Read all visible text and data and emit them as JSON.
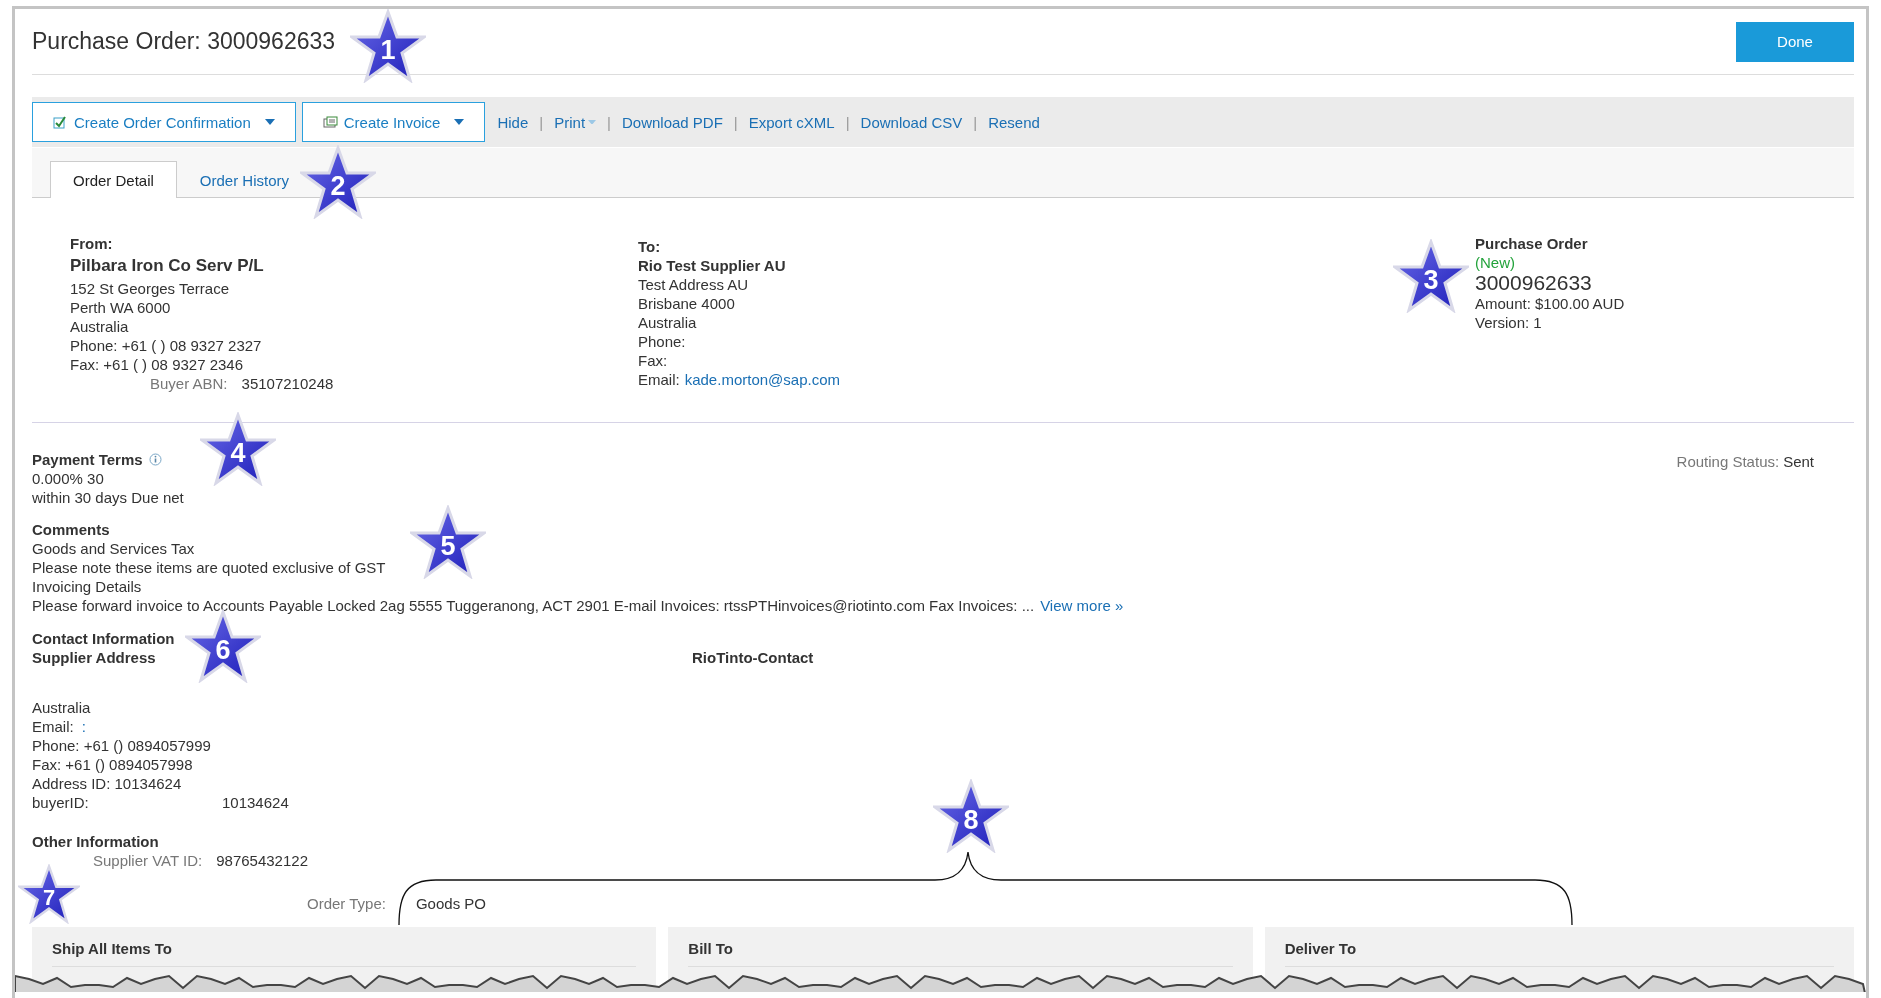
{
  "title": "Purchase Order: 3000962633",
  "done_button": "Done",
  "toolbar": {
    "buttons": [
      {
        "label": "Create Order Confirmation"
      },
      {
        "label": "Create Invoice"
      }
    ],
    "links": [
      {
        "label": "Hide",
        "dropdown": false
      },
      {
        "label": "Print",
        "dropdown": true,
        "separator_before": "|"
      },
      {
        "label": "Download PDF",
        "dropdown": false,
        "separator_before": "|"
      },
      {
        "label": "Export cXML",
        "dropdown": false,
        "separator_before": "|"
      },
      {
        "label": "Download CSV",
        "dropdown": false,
        "separator_before": "|"
      },
      {
        "label": "Resend",
        "dropdown": false,
        "separator_before": "|"
      }
    ]
  },
  "tabs": [
    {
      "label": "Order Detail",
      "selected": true
    },
    {
      "label": "Order History",
      "selected": false
    }
  ],
  "from": {
    "heading": "From:",
    "name": "Pilbara Iron Co Serv P/L",
    "lines": [
      "152 St Georges Terrace",
      "Perth WA 6000",
      "Australia",
      "Phone:  +61 ( ) 08 9327 2327",
      "Fax:  +61 ( ) 08 9327 2346"
    ],
    "buyer_abn": {
      "label": "Buyer ABN:",
      "value": "35107210248"
    }
  },
  "to": {
    "heading": "To:",
    "name": "Rio Test Supplier AU",
    "lines": [
      "Test Address AU",
      "Brisbane 4000",
      "Australia",
      "Phone:",
      "Fax:"
    ],
    "email": {
      "label": "Email:",
      "value": "kade.morton@sap.com"
    }
  },
  "po_summary": {
    "heading": "Purchase Order",
    "status": "(New)",
    "number": "3000962633",
    "amount": "Amount: $100.00 AUD",
    "version": "Version: 1"
  },
  "payment_terms": {
    "heading": "Payment Terms",
    "lines": [
      "0.000% 30",
      "within 30 days Due net"
    ]
  },
  "routing_status": {
    "label": "Routing Status:",
    "value": "Sent"
  },
  "comments": {
    "heading": "Comments",
    "lines": [
      "Goods and Services Tax",
      "Please note these items are quoted exclusive of GST",
      "Invoicing Details",
      "Please forward invoice to Accounts Payable Locked 2ag 5555 Tuggeranong, ACT 2901 E-mail Invoices: rtssPTHinvoices@riotinto.com Fax Invoices:  ..."
    ],
    "view_more": "View more »"
  },
  "contact": {
    "heading": "Contact Information",
    "subheading": "Supplier Address",
    "contact_name": "RioTinto-Contact",
    "lines": [
      {
        "kind": "text",
        "text": "Australia"
      },
      {
        "kind": "link",
        "label": "Email:",
        "value": ":"
      },
      {
        "kind": "text",
        "text": "Phone:  +61 () 0894057999"
      },
      {
        "kind": "text",
        "text": "Fax:  +61 () 0894057998"
      },
      {
        "kind": "text",
        "text": "Address ID:  10134624"
      },
      {
        "kind": "tab",
        "label": "buyerID:",
        "value": "10134624"
      }
    ]
  },
  "other_information": {
    "heading": "Other Information",
    "fields": [
      {
        "label": "Supplier VAT ID:",
        "value": "98765432122"
      },
      {
        "label": "Order Type:",
        "value": "Goods PO"
      }
    ]
  },
  "address_cards": [
    {
      "title": "Ship All Items To"
    },
    {
      "title": "Bill To"
    },
    {
      "title": "Deliver To"
    }
  ],
  "annotations": [
    {
      "number": "1"
    },
    {
      "number": "2"
    },
    {
      "number": "3"
    },
    {
      "number": "4"
    },
    {
      "number": "5"
    },
    {
      "number": "6"
    },
    {
      "number": "7"
    },
    {
      "number": "8"
    }
  ]
}
